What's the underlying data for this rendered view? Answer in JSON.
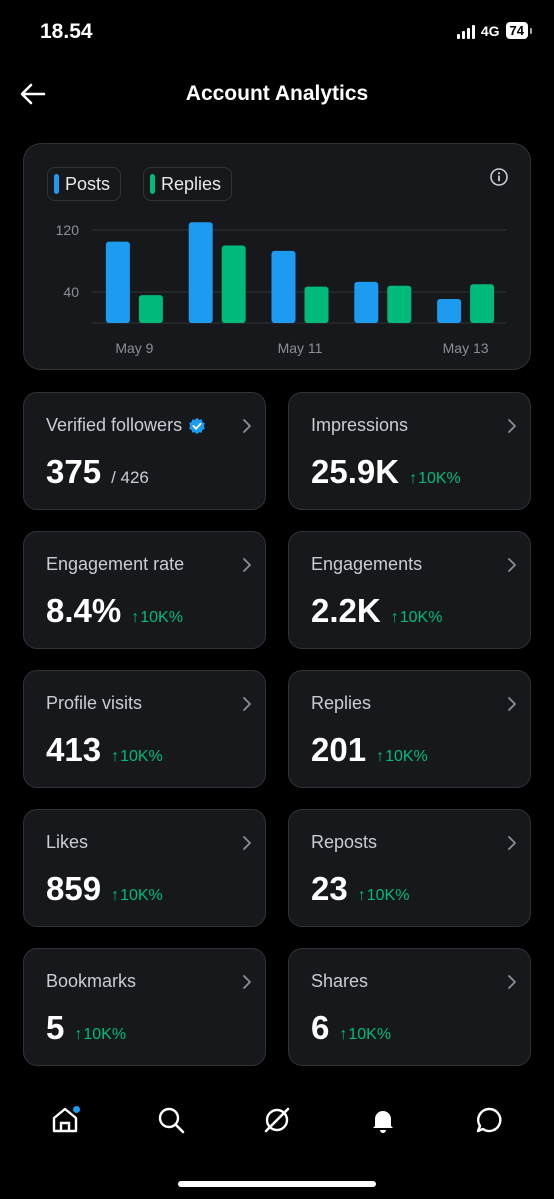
{
  "status_bar": {
    "time": "18.54",
    "network": "4G",
    "battery": "74"
  },
  "header": {
    "title": "Account Analytics"
  },
  "chart_data": {
    "type": "bar",
    "series": [
      {
        "name": "Posts",
        "color": "#1d9bf0",
        "values": [
          105,
          130,
          93,
          53,
          31
        ]
      },
      {
        "name": "Replies",
        "color": "#00ba7c",
        "values": [
          36,
          100,
          47,
          48,
          50
        ]
      }
    ],
    "categories": [
      "May 9",
      "",
      "May 11",
      "",
      "May 13"
    ],
    "x_tick_labels": [
      "May 9",
      "May 11",
      "May 13"
    ],
    "y_ticks": [
      40,
      120
    ],
    "ylim": [
      0,
      140
    ],
    "grid": true,
    "legend_position": "top-left"
  },
  "metrics": [
    {
      "label": "Verified followers",
      "value": "375",
      "sub": "/ 426",
      "change": "",
      "verified": true
    },
    {
      "label": "Impressions",
      "value": "25.9K",
      "sub": "",
      "change": "10K%"
    },
    {
      "label": "Engagement rate",
      "value": "8.4%",
      "sub": "",
      "change": "10K%"
    },
    {
      "label": "Engagements",
      "value": "2.2K",
      "sub": "",
      "change": "10K%"
    },
    {
      "label": "Profile visits",
      "value": "413",
      "sub": "",
      "change": "10K%"
    },
    {
      "label": "Replies",
      "value": "201",
      "sub": "",
      "change": "10K%"
    },
    {
      "label": "Likes",
      "value": "859",
      "sub": "",
      "change": "10K%"
    },
    {
      "label": "Reposts",
      "value": "23",
      "sub": "",
      "change": "10K%"
    },
    {
      "label": "Bookmarks",
      "value": "5",
      "sub": "",
      "change": "10K%"
    },
    {
      "label": "Shares",
      "value": "6",
      "sub": "",
      "change": "10K%"
    }
  ],
  "change_arrow": "↑",
  "nav": {
    "items": [
      "home-icon",
      "search-icon",
      "grok-icon",
      "notifications-icon",
      "messages-icon"
    ],
    "accent": "#1d9bf0"
  }
}
